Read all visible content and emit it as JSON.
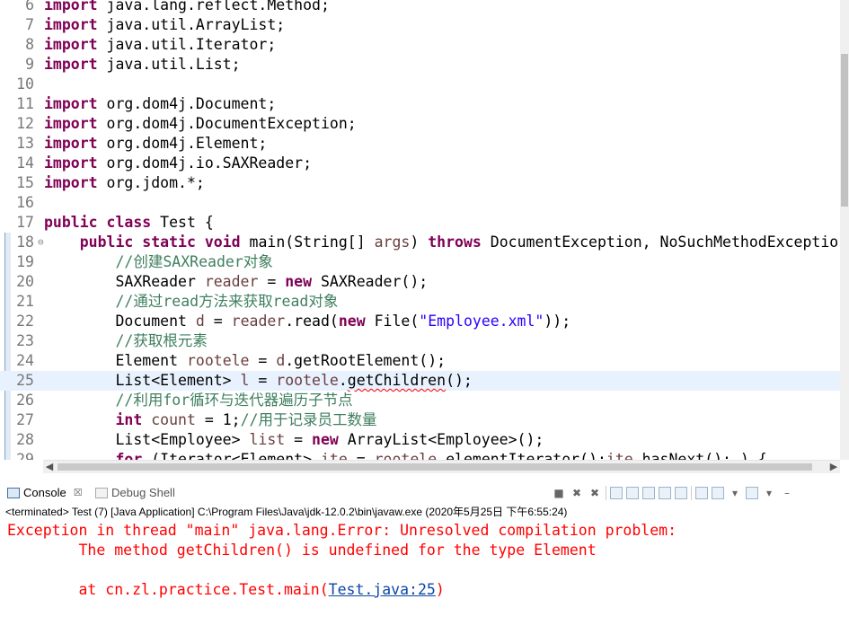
{
  "editor": {
    "lines": [
      {
        "n": "6",
        "segs": [
          [
            "kw",
            "import"
          ],
          [
            "t",
            " java.lang.reflect.Method;"
          ]
        ]
      },
      {
        "n": "7",
        "segs": [
          [
            "kw",
            "import"
          ],
          [
            "t",
            " java.util.ArrayList;"
          ]
        ]
      },
      {
        "n": "8",
        "segs": [
          [
            "kw",
            "import"
          ],
          [
            "t",
            " java.util.Iterator;"
          ]
        ]
      },
      {
        "n": "9",
        "segs": [
          [
            "kw",
            "import"
          ],
          [
            "t",
            " java.util.List;"
          ]
        ]
      },
      {
        "n": "10",
        "segs": []
      },
      {
        "n": "11",
        "segs": [
          [
            "kw",
            "import"
          ],
          [
            "t",
            " org.dom4j.Document;"
          ]
        ]
      },
      {
        "n": "12",
        "segs": [
          [
            "kw",
            "import"
          ],
          [
            "t",
            " org.dom4j.DocumentException;"
          ]
        ]
      },
      {
        "n": "13",
        "segs": [
          [
            "kw",
            "import"
          ],
          [
            "t",
            " org.dom4j.Element;"
          ]
        ]
      },
      {
        "n": "14",
        "segs": [
          [
            "kw",
            "import"
          ],
          [
            "t",
            " org.dom4j.io.SAXReader;"
          ]
        ]
      },
      {
        "n": "15",
        "segs": [
          [
            "kw",
            "import"
          ],
          [
            "t",
            " org.jdom.*;"
          ]
        ]
      },
      {
        "n": "16",
        "segs": []
      },
      {
        "n": "17",
        "segs": [
          [
            "kw",
            "public"
          ],
          [
            "t",
            " "
          ],
          [
            "kw",
            "class"
          ],
          [
            "t",
            " Test {"
          ]
        ]
      },
      {
        "n": "18",
        "fold": "⊖",
        "segs": [
          [
            "t",
            "    "
          ],
          [
            "kw",
            "public"
          ],
          [
            "t",
            " "
          ],
          [
            "kw",
            "static"
          ],
          [
            "t",
            " "
          ],
          [
            "kw",
            "void"
          ],
          [
            "t",
            " main(String[] "
          ],
          [
            "var",
            "args"
          ],
          [
            "t",
            ") "
          ],
          [
            "kw",
            "throws"
          ],
          [
            "t",
            " DocumentException, NoSuchMethodExceptio"
          ]
        ]
      },
      {
        "n": "19",
        "segs": [
          [
            "t",
            "        "
          ],
          [
            "cm",
            "//创建SAXReader对象"
          ]
        ]
      },
      {
        "n": "20",
        "segs": [
          [
            "t",
            "        SAXReader "
          ],
          [
            "var",
            "reader"
          ],
          [
            "t",
            " = "
          ],
          [
            "kw",
            "new"
          ],
          [
            "t",
            " SAXReader();"
          ]
        ]
      },
      {
        "n": "21",
        "segs": [
          [
            "t",
            "        "
          ],
          [
            "cm",
            "//通过read方法来获取read对象"
          ]
        ]
      },
      {
        "n": "22",
        "segs": [
          [
            "t",
            "        Document "
          ],
          [
            "var",
            "d"
          ],
          [
            "t",
            " = "
          ],
          [
            "var",
            "reader"
          ],
          [
            "t",
            ".read("
          ],
          [
            "kw",
            "new"
          ],
          [
            "t",
            " File("
          ],
          [
            "str",
            "\"Employee.xml\""
          ],
          [
            "t",
            "));"
          ]
        ]
      },
      {
        "n": "23",
        "segs": [
          [
            "t",
            "        "
          ],
          [
            "cm",
            "//获取根元素"
          ]
        ]
      },
      {
        "n": "24",
        "segs": [
          [
            "t",
            "        Element "
          ],
          [
            "var",
            "rootele"
          ],
          [
            "t",
            " = "
          ],
          [
            "var",
            "d"
          ],
          [
            "t",
            ".getRootElement();"
          ]
        ]
      },
      {
        "n": "25",
        "current": true,
        "segs": [
          [
            "t",
            "        List<Element> "
          ],
          [
            "var",
            "l"
          ],
          [
            "t",
            " = "
          ],
          [
            "var",
            "rootele"
          ],
          [
            "t",
            "."
          ],
          [
            "err",
            "getChildren"
          ],
          [
            "t",
            "();"
          ]
        ]
      },
      {
        "n": "26",
        "segs": [
          [
            "t",
            "        "
          ],
          [
            "cm",
            "//利用for循环与迭代器遍历子节点"
          ]
        ]
      },
      {
        "n": "27",
        "segs": [
          [
            "t",
            "        "
          ],
          [
            "kw",
            "int"
          ],
          [
            "t",
            " "
          ],
          [
            "var",
            "count"
          ],
          [
            "t",
            " = 1;"
          ],
          [
            "cm",
            "//用于记录员工数量"
          ]
        ]
      },
      {
        "n": "28",
        "segs": [
          [
            "t",
            "        List<Employee> "
          ],
          [
            "var",
            "list"
          ],
          [
            "t",
            " = "
          ],
          [
            "kw",
            "new"
          ],
          [
            "t",
            " ArrayList<Employee>();"
          ]
        ]
      },
      {
        "n": "29",
        "segs": [
          [
            "t",
            "        "
          ],
          [
            "kw",
            "for"
          ],
          [
            "t",
            " (Iterator<Element> "
          ],
          [
            "var",
            "ite"
          ],
          [
            "t",
            " = "
          ],
          [
            "var",
            "rootele"
          ],
          [
            "t",
            ".elementIterator();"
          ],
          [
            "var",
            "ite"
          ],
          [
            "t",
            ".hasNext(); ) {"
          ]
        ]
      }
    ]
  },
  "console": {
    "tabs": [
      {
        "label": "Console",
        "icon": "console-icon",
        "active": true
      },
      {
        "label": "Debug Shell",
        "icon": "debug-shell-icon",
        "active": false
      }
    ],
    "status": "<terminated> Test (7) [Java Application] C:\\Program Files\\Java\\jdk-12.0.2\\bin\\javaw.exe (2020年5月25日 下午6:55:24)",
    "output": {
      "line1": "Exception in thread \"main\" java.lang.Error: Unresolved compilation problem: ",
      "line2": "\tThe method getChildren() is undefined for the type Element",
      "line3": "",
      "line4_prefix": "\tat cn.zl.practice.Test.main(",
      "line4_link": "Test.java:25",
      "line4_suffix": ")"
    }
  }
}
